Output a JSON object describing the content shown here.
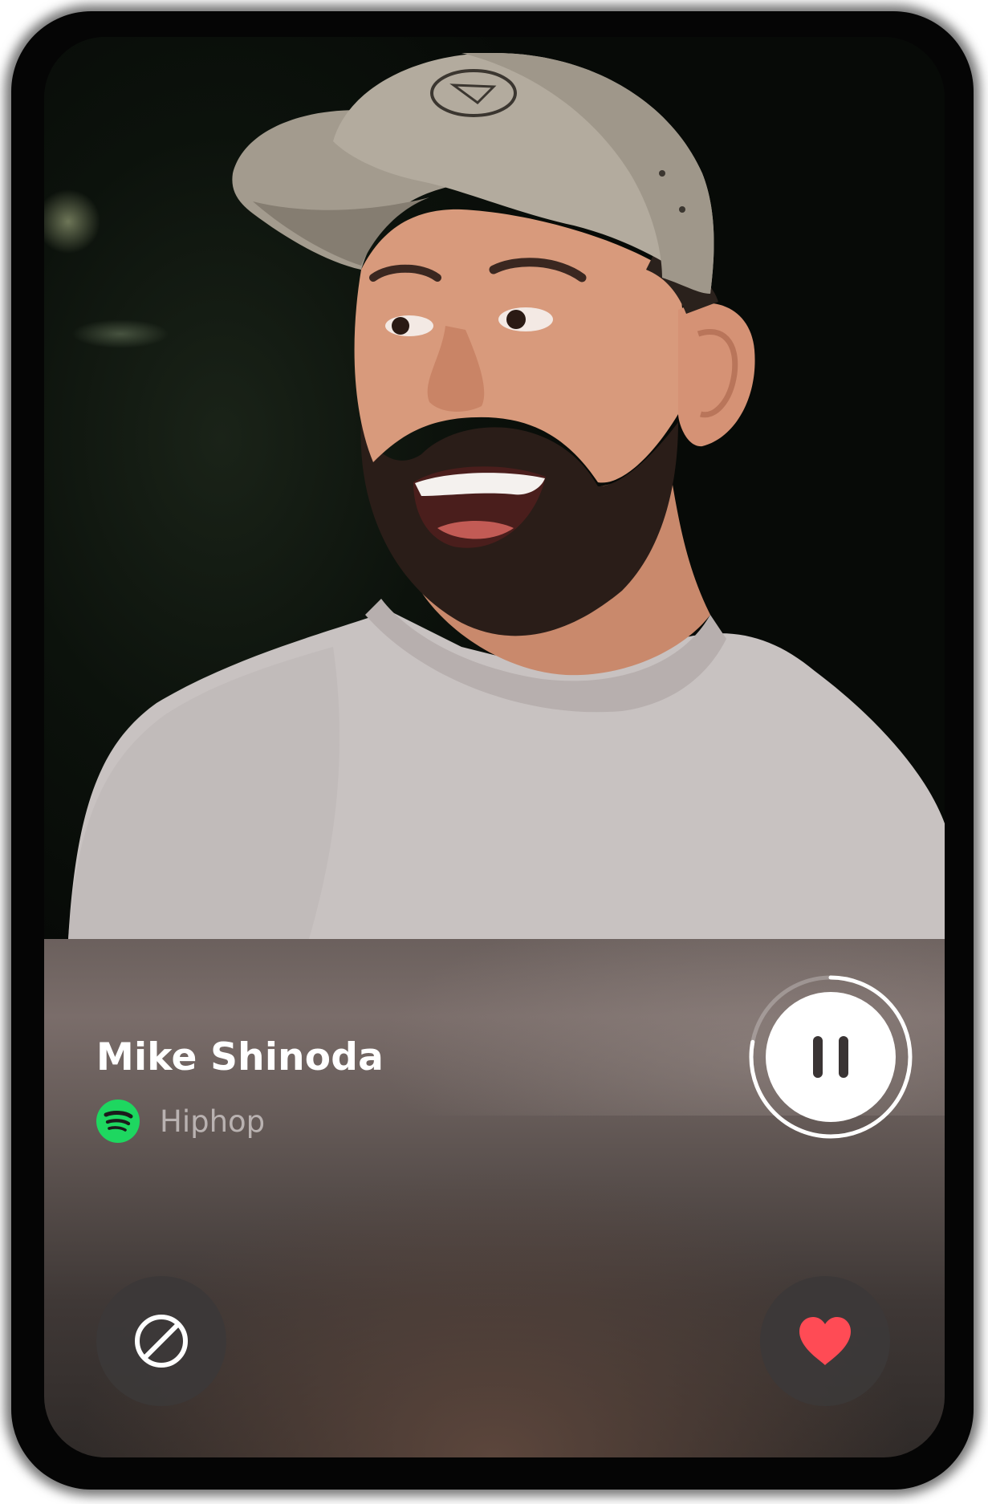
{
  "profile": {
    "name": "Mike Shinoda",
    "genre": "Hiphop",
    "genre_source_icon": "spotify-icon",
    "photo_description_icon": "profile-photo"
  },
  "player": {
    "state": "playing",
    "control_icon": "pause-icon",
    "progress_fraction": 0.78
  },
  "actions": {
    "skip_icon": "block-icon",
    "like_icon": "heart-icon"
  },
  "colors": {
    "spotify_green": "#1ED760",
    "heart_red": "#FF4B55",
    "panel_base": "#6b605d",
    "text_primary": "#FFFFFF",
    "text_secondary": "#B9B2B1"
  }
}
